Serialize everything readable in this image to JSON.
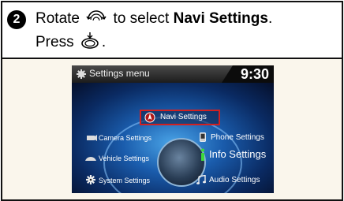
{
  "step": {
    "number": "2",
    "line1_prefix": "Rotate",
    "line1_middle": "to select",
    "line1_bold": "Navi Settings",
    "line1_suffix": ".",
    "line2_prefix": "Press",
    "line2_suffix": ".",
    "rotate_icon": "rotate-dial-icon",
    "press_icon": "press-dial-icon"
  },
  "screen": {
    "title": "Settings menu",
    "clock": "9:30",
    "items": {
      "navi": "Navi Settings",
      "camera": "Camera Settings",
      "vehicle": "Vehicle Settings",
      "system": "System Settings",
      "phone": "Phone Settings",
      "info": "Info Settings",
      "audio": "Audio Settings"
    },
    "highlight_color": "#d22020",
    "accent_color": "#1a5cac"
  }
}
